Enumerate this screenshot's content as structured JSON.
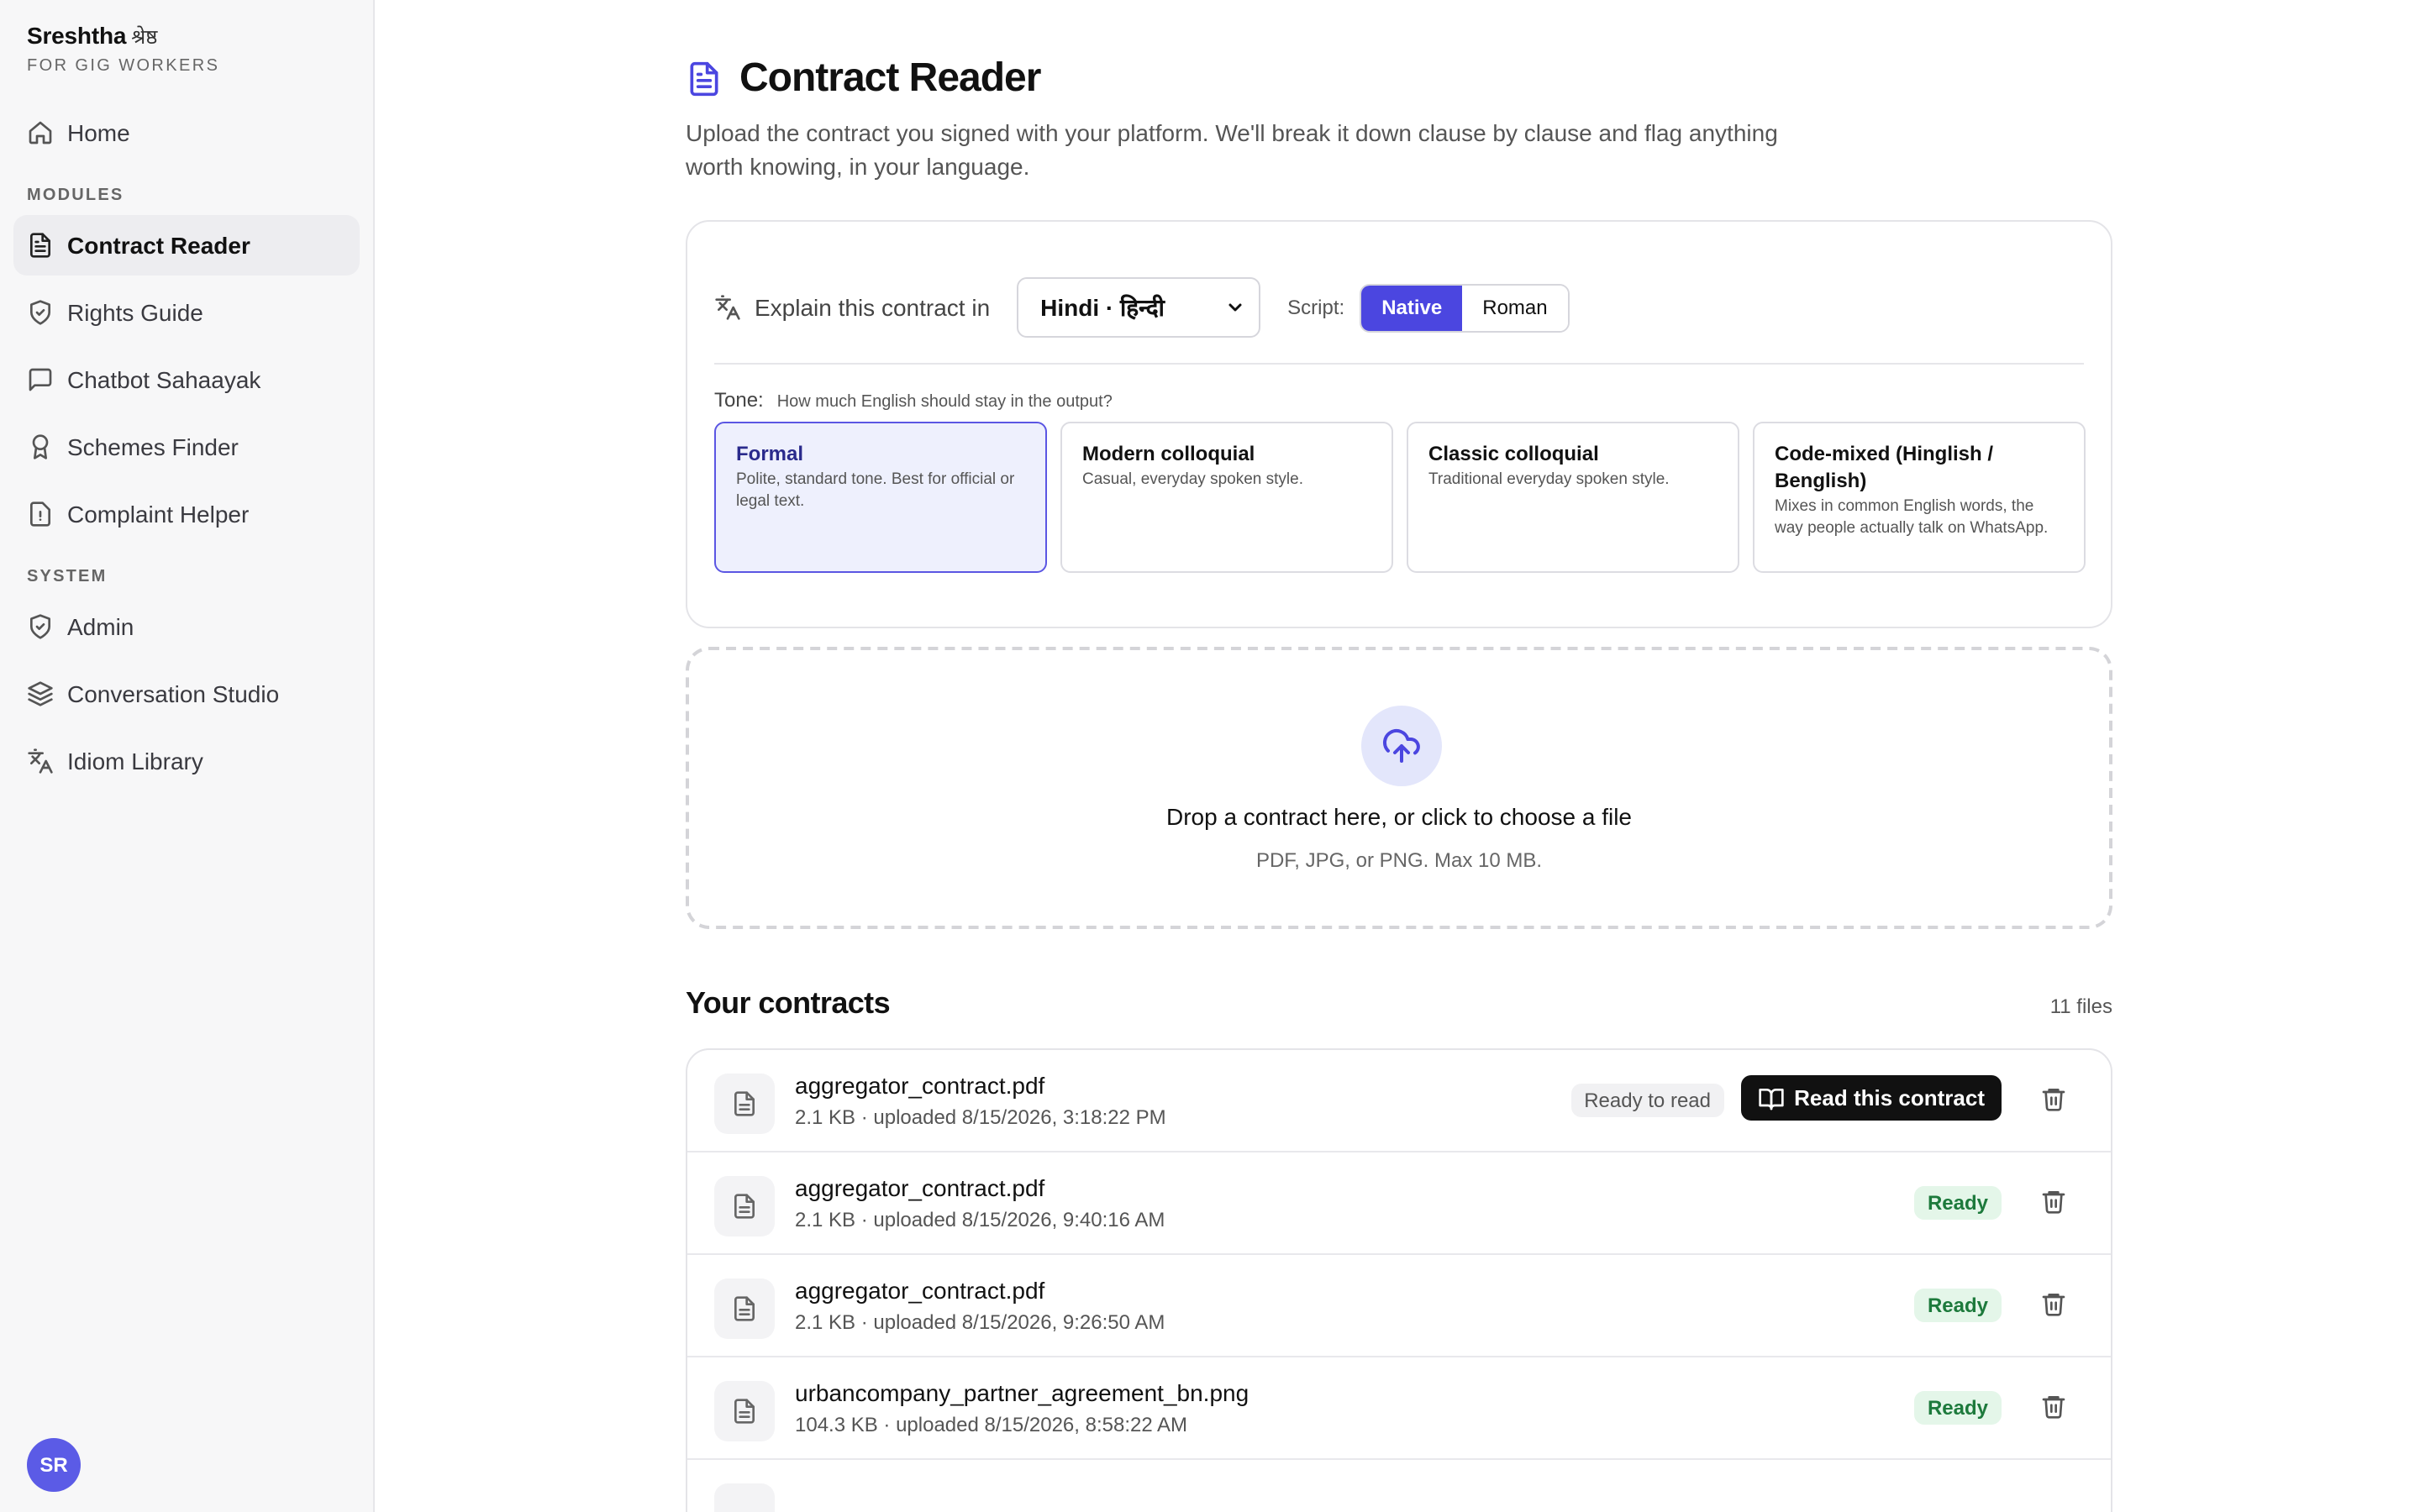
{
  "brand": {
    "name": "Sreshtha",
    "native": "श्रेष्ठ",
    "subtitle": "FOR GIG WORKERS"
  },
  "sidebar": {
    "home": "Home",
    "modules_heading": "MODULES",
    "modules": [
      "Contract Reader",
      "Rights Guide",
      "Chatbot Sahaayak",
      "Schemes Finder",
      "Complaint Helper"
    ],
    "system_heading": "SYSTEM",
    "system": [
      "Admin",
      "Conversation Studio",
      "Idiom Library"
    ],
    "active": "Contract Reader",
    "avatar_initials": "SR"
  },
  "page": {
    "title": "Contract Reader",
    "description": "Upload the contract you signed with your platform. We'll break it down clause by clause and flag anything worth knowing, in your language."
  },
  "settings": {
    "explain_label": "Explain this contract in",
    "language": "Hindi · हिन्दी",
    "script_label": "Script:",
    "script_options": [
      "Native",
      "Roman"
    ],
    "script_selected": "Native",
    "tone_label": "Tone:",
    "tone_hint": "How much English should stay in the output?",
    "tones": [
      {
        "name": "Formal",
        "desc": "Polite, standard tone. Best for official or legal text."
      },
      {
        "name": "Modern colloquial",
        "desc": "Casual, everyday spoken style."
      },
      {
        "name": "Classic colloquial",
        "desc": "Traditional everyday spoken style."
      },
      {
        "name": "Code-mixed (Hinglish / Benglish)",
        "desc": "Mixes in common English words, the way people actually talk on WhatsApp."
      }
    ],
    "tone_selected": "Formal"
  },
  "upload": {
    "title": "Drop a contract here, or click to choose a file",
    "subtitle": "PDF, JPG, or PNG. Max 10 MB."
  },
  "contracts": {
    "heading": "Your contracts",
    "count": "11 files",
    "read_button": "Read this contract",
    "items": [
      {
        "name": "aggregator_contract.pdf",
        "meta": "2.1 KB · uploaded 8/15/2026, 3:18:22 PM",
        "status": "Ready to read"
      },
      {
        "name": "aggregator_contract.pdf",
        "meta": "2.1 KB · uploaded 8/15/2026, 9:40:16 AM",
        "status": "Ready"
      },
      {
        "name": "aggregator_contract.pdf",
        "meta": "2.1 KB · uploaded 8/15/2026, 9:26:50 AM",
        "status": "Ready"
      },
      {
        "name": "urbancompany_partner_agreement_bn.png",
        "meta": "104.3 KB · uploaded 8/15/2026, 8:58:22 AM",
        "status": "Ready"
      }
    ]
  },
  "colors": {
    "accent": "#4b46e0",
    "ready_bg": "#e4f6e9",
    "ready_text": "#1d7a3c",
    "avatar": "#5b5be6"
  }
}
